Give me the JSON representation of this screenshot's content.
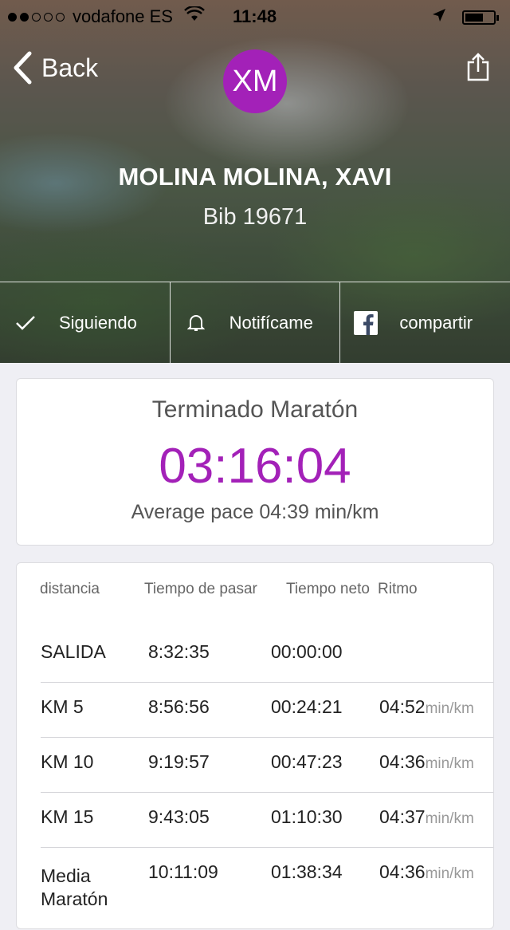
{
  "status_bar": {
    "carrier": "vodafone ES",
    "time": "11:48"
  },
  "nav": {
    "back_label": "Back"
  },
  "runner": {
    "initials": "XM",
    "name": "MOLINA MOLINA, XAVI",
    "bib": "Bib 19671"
  },
  "actions": {
    "follow": "Siguiendo",
    "notify": "Notifícame",
    "share": "compartir"
  },
  "result": {
    "status": "Terminado Maratón",
    "time": "03:16:04",
    "pace": "Average pace 04:39 min/km"
  },
  "splits": {
    "headers": {
      "distance": "distancia",
      "pass_time": "Tiempo de pasar",
      "net_time": "Tiempo neto",
      "pace": "Ritmo"
    },
    "rows": [
      {
        "distance": "SALIDA",
        "pass_time": "8:32:35",
        "net_time": "00:00:00",
        "pace": "",
        "unit": ""
      },
      {
        "distance": "KM 5",
        "pass_time": "8:56:56",
        "net_time": "00:24:21",
        "pace": "04:52",
        "unit": "min/km"
      },
      {
        "distance": "KM 10",
        "pass_time": "9:19:57",
        "net_time": "00:47:23",
        "pace": "04:36",
        "unit": "min/km"
      },
      {
        "distance": "KM 15",
        "pass_time": "9:43:05",
        "net_time": "01:10:30",
        "pace": "04:37",
        "unit": "min/km"
      },
      {
        "distance": "Media Maratón",
        "pass_time": "10:11:09",
        "net_time": "01:38:34",
        "pace": "04:36",
        "unit": "min/km"
      }
    ]
  },
  "colors": {
    "accent": "#a321b8"
  }
}
